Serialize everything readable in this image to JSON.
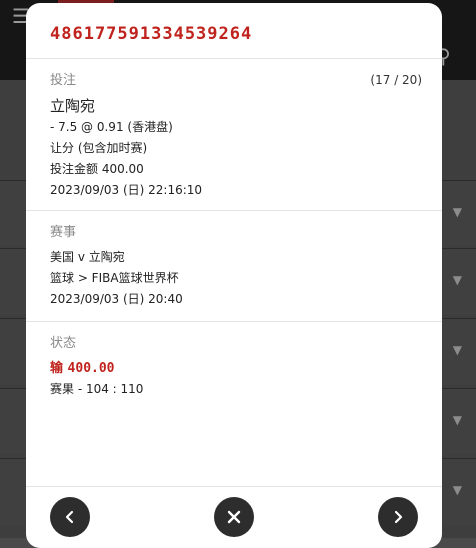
{
  "ticket": {
    "id": "486177591334539264",
    "bet": {
      "label": "投注",
      "counter": "(17 / 20)",
      "selection": "立陶宛",
      "odds_line": "- 7.5 @ 0.91 (香港盘)",
      "market": "让分 (包含加时赛)",
      "stake": "投注金额 400.00",
      "placed_time": "2023/09/03 (日) 22:16:10"
    },
    "event": {
      "label": "赛事",
      "match": "美国 v 立陶宛",
      "league": "篮球 > FIBA篮球世界杯",
      "start_time": "2023/09/03 (日) 20:40"
    },
    "status": {
      "label": "状态",
      "result_word": "输",
      "amount": "400.00",
      "score": "赛果 - 104 : 110"
    }
  },
  "controls": {
    "prev": "chevron-left-icon",
    "close": "close-icon",
    "next": "chevron-right-icon"
  },
  "colors": {
    "accent_red": "#c0231d",
    "nav_button": "#2d2d2d"
  }
}
